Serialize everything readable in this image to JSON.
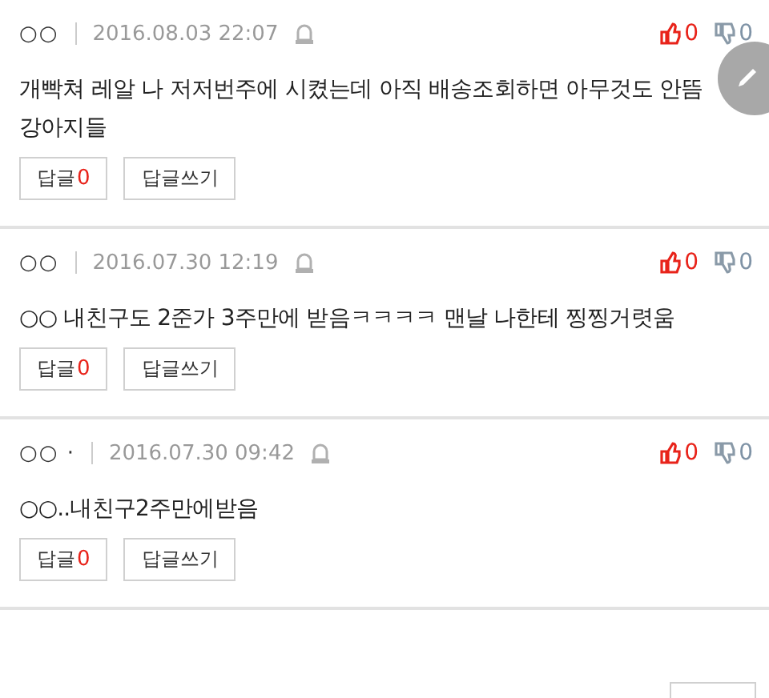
{
  "comments": [
    {
      "author": "○○",
      "date": "2016.08.03 22:07",
      "likes": "0",
      "dislikes": "0",
      "body": "개빡쳐 레알 나 저저번주에 시켰는데 아직 배송조회하면 아무것도 안뜸 강아지들",
      "reply_label": "답글",
      "reply_count": "0",
      "write_label": "답글쓰기"
    },
    {
      "author": "○○",
      "date": "2016.07.30 12:19",
      "likes": "0",
      "dislikes": "0",
      "body": "○○ 내친구도 2준가 3주만에 받음ㅋㅋㅋㅋ 맨날 나한테 찡찡거렷움",
      "reply_label": "답글",
      "reply_count": "0",
      "write_label": "답글쓰기"
    },
    {
      "author": "○○ ·",
      "date": "2016.07.30 09:42",
      "likes": "0",
      "dislikes": "0",
      "body": "○○..내친구2주만에받음",
      "reply_label": "답글",
      "reply_count": "0",
      "write_label": "답글쓰기"
    }
  ]
}
